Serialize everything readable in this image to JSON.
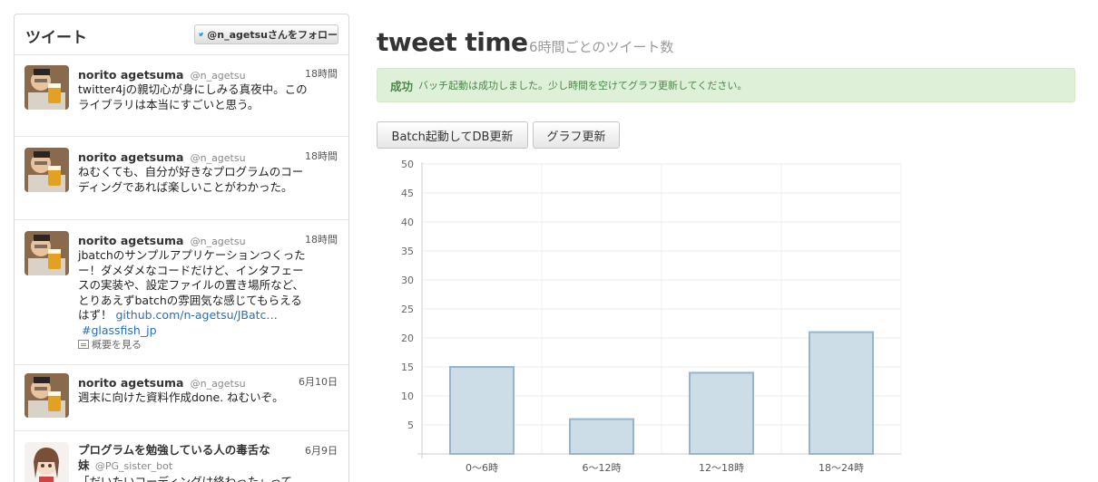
{
  "widget": {
    "title": "ツイート",
    "follow_label": "@n_agetsuさんをフォロー",
    "tweets": [
      {
        "name": "norito agetsuma",
        "handle": "@n_agetsu",
        "time": "18時間",
        "lines": [
          "twitter4jの親切心が身にしみる真夜中。この",
          "ライブラリは本当にすごいと思う。"
        ]
      },
      {
        "name": "norito agetsuma",
        "handle": "@n_agetsu",
        "time": "18時間",
        "lines": [
          "ねむくても、自分が好きなプログラムのコー",
          "ディングであれば楽しいことがわかった。"
        ]
      },
      {
        "name": "norito agetsuma",
        "handle": "@n_agetsu",
        "time": "18時間",
        "lines": [
          "jbatchのサンプルアプリケーションつくった",
          "ー！ダメダメなコードだけど、インタフェー",
          "スの実装や、設定ファイルの置き場所など、",
          "とりあえずbatchの雰囲気な感じてもらえる"
        ],
        "last_line_prefix": "はず！ ",
        "link": "github.com/n-agetsu/JBatc…",
        "hashtag": "#glassfish_jp",
        "summary": "概要を見る"
      },
      {
        "name": "norito agetsuma",
        "handle": "@n_agetsu",
        "time": "6月10日",
        "lines": [
          "週末に向けた資料作成done. ねむいぞ。"
        ]
      },
      {
        "name_line1": "プログラムを勉強している人の毒舌な",
        "name_line2": "妹",
        "handle": "@PG_sister_bot",
        "time": "6月9日",
        "lines": [
          "「だいたいコーディングは終わった」って"
        ]
      }
    ]
  },
  "main": {
    "title": "tweet time",
    "subtitle": "6時間ごとのツイート数",
    "alert": {
      "strong": "成功",
      "message": "バッチ起動は成功しました。少し時間を空けてグラフ更新してください。"
    },
    "buttons": {
      "batch": "Batch起動してDB更新",
      "graph": "グラフ更新"
    }
  },
  "chart_data": {
    "type": "bar",
    "categories": [
      "0〜6時",
      "6〜12時",
      "12〜18時",
      "18〜24時"
    ],
    "values": [
      15,
      6,
      14,
      21
    ],
    "ylim": [
      0,
      50
    ],
    "yticks": [
      5,
      10,
      15,
      20,
      25,
      30,
      35,
      40,
      45,
      50
    ],
    "grid": true,
    "bar_fill": "#cddde8",
    "bar_stroke": "#95b5cb"
  },
  "colors": {
    "alert_bg": "#dff0d8",
    "alert_text": "#468847",
    "link": "#2a6fb1"
  }
}
